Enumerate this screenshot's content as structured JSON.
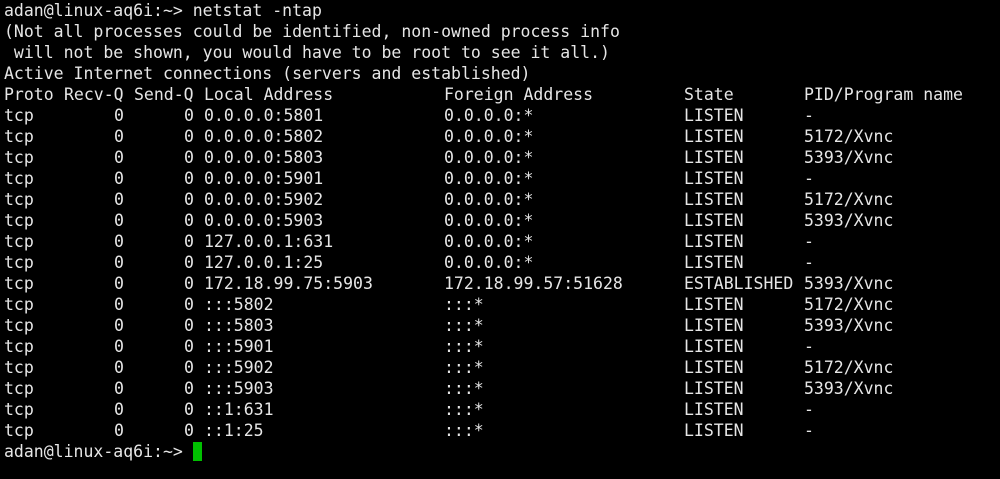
{
  "terminal": {
    "prompt": "adan@linux-aq6i:~>",
    "command": "netstat -ntap",
    "notice_lines": [
      "(Not all processes could be identified, non-owned process info",
      " will not be shown, you would have to be root to see it all.)"
    ],
    "section_title": "Active Internet connections (servers and established)",
    "columns": {
      "proto": "Proto",
      "recvq": "Recv-Q",
      "sendq": "Send-Q",
      "local": "Local Address",
      "foreign": "Foreign Address",
      "state": "State",
      "pid": "PID/Program name"
    },
    "rows": [
      {
        "proto": "tcp",
        "recvq": "0",
        "sendq": "0",
        "local": "0.0.0.0:5801",
        "foreign": "0.0.0.0:*",
        "state": "LISTEN",
        "pid": "-"
      },
      {
        "proto": "tcp",
        "recvq": "0",
        "sendq": "0",
        "local": "0.0.0.0:5802",
        "foreign": "0.0.0.0:*",
        "state": "LISTEN",
        "pid": "5172/Xvnc"
      },
      {
        "proto": "tcp",
        "recvq": "0",
        "sendq": "0",
        "local": "0.0.0.0:5803",
        "foreign": "0.0.0.0:*",
        "state": "LISTEN",
        "pid": "5393/Xvnc"
      },
      {
        "proto": "tcp",
        "recvq": "0",
        "sendq": "0",
        "local": "0.0.0.0:5901",
        "foreign": "0.0.0.0:*",
        "state": "LISTEN",
        "pid": "-"
      },
      {
        "proto": "tcp",
        "recvq": "0",
        "sendq": "0",
        "local": "0.0.0.0:5902",
        "foreign": "0.0.0.0:*",
        "state": "LISTEN",
        "pid": "5172/Xvnc"
      },
      {
        "proto": "tcp",
        "recvq": "0",
        "sendq": "0",
        "local": "0.0.0.0:5903",
        "foreign": "0.0.0.0:*",
        "state": "LISTEN",
        "pid": "5393/Xvnc"
      },
      {
        "proto": "tcp",
        "recvq": "0",
        "sendq": "0",
        "local": "127.0.0.1:631",
        "foreign": "0.0.0.0:*",
        "state": "LISTEN",
        "pid": "-"
      },
      {
        "proto": "tcp",
        "recvq": "0",
        "sendq": "0",
        "local": "127.0.0.1:25",
        "foreign": "0.0.0.0:*",
        "state": "LISTEN",
        "pid": "-"
      },
      {
        "proto": "tcp",
        "recvq": "0",
        "sendq": "0",
        "local": "172.18.99.75:5903",
        "foreign": "172.18.99.57:51628",
        "state": "ESTABLISHED",
        "pid": "5393/Xvnc"
      },
      {
        "proto": "tcp",
        "recvq": "0",
        "sendq": "0",
        "local": ":::5802",
        "foreign": ":::*",
        "state": "LISTEN",
        "pid": "5172/Xvnc"
      },
      {
        "proto": "tcp",
        "recvq": "0",
        "sendq": "0",
        "local": ":::5803",
        "foreign": ":::*",
        "state": "LISTEN",
        "pid": "5393/Xvnc"
      },
      {
        "proto": "tcp",
        "recvq": "0",
        "sendq": "0",
        "local": ":::5901",
        "foreign": ":::*",
        "state": "LISTEN",
        "pid": "-"
      },
      {
        "proto": "tcp",
        "recvq": "0",
        "sendq": "0",
        "local": ":::5902",
        "foreign": ":::*",
        "state": "LISTEN",
        "pid": "5172/Xvnc"
      },
      {
        "proto": "tcp",
        "recvq": "0",
        "sendq": "0",
        "local": ":::5903",
        "foreign": ":::*",
        "state": "LISTEN",
        "pid": "5393/Xvnc"
      },
      {
        "proto": "tcp",
        "recvq": "0",
        "sendq": "0",
        "local": "::1:631",
        "foreign": ":::*",
        "state": "LISTEN",
        "pid": "-"
      },
      {
        "proto": "tcp",
        "recvq": "0",
        "sendq": "0",
        "local": "::1:25",
        "foreign": ":::*",
        "state": "LISTEN",
        "pid": "-"
      }
    ],
    "final_prompt": "adan@linux-aq6i:~>",
    "cursor_color": "#00c000"
  },
  "colors": {
    "background": "#000000",
    "foreground": "#e6e6e6",
    "cursor": "#00c000"
  }
}
